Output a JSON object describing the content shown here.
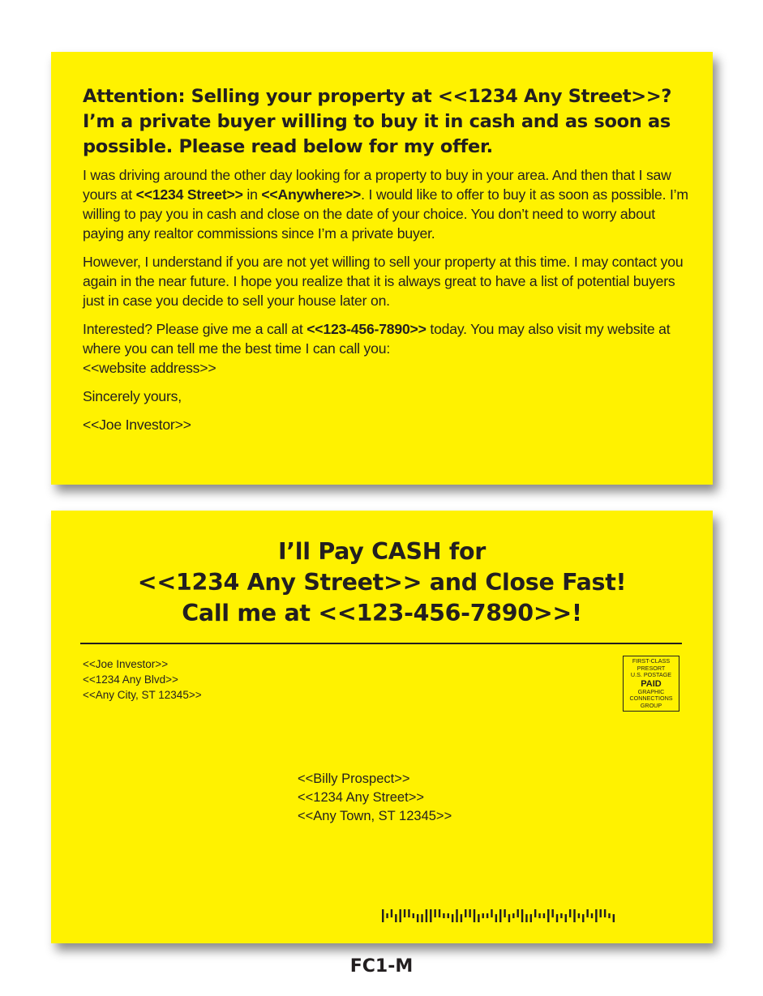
{
  "back": {
    "headline": "Attention: Selling your property at <<1234 Any Street>>? I’m a private buyer willing to buy it in cash and as soon as possible. Please read below for my offer.",
    "p1": {
      "t1": "I was driving around the other day looking for a property to buy in your area. And then that I saw yours at ",
      "b1": "<<1234 Street>>",
      "t2": " in ",
      "b2": "<<Anywhere>>",
      "t3": ". I would like to offer to buy it as soon as possible. I’m willing to pay you in cash and close on the date of your choice. You don’t need to worry about paying any realtor commissions since I’m a private buyer."
    },
    "p2": "However, I understand if you are not yet willing to sell your property at this time. I may contact you again in the near future. I hope you realize that it is always great to have a list of potential buyers just in case you decide to sell your house later on.",
    "p3": {
      "t1": "Interested? Please give me a call at ",
      "b1": "<<123-456-7890>>",
      "t2": " today. You may also visit my website at where you can tell me the best time I can call you:",
      "t3": "<<website address>>"
    },
    "closing": "Sincerely yours,",
    "signature": "<<Joe Investor>>"
  },
  "front": {
    "headline_lines": [
      "I’ll Pay CASH for",
      "<<1234 Any Street>> and Close Fast!",
      "Call me at <<123-456-7890>>!"
    ],
    "return_address": [
      "<<Joe Investor>>",
      "<<1234 Any Blvd>>",
      "<<Any City, ST 12345>>"
    ],
    "indicia": {
      "line1": "FIRST-CLASS",
      "line2": "PRESORT",
      "line3": "U.S. POSTAGE",
      "paid": "PAID",
      "line4": "GRAPHIC",
      "line5": "CONNECTIONS",
      "line6": "GROUP"
    },
    "recipient": [
      "<<Billy Prospect>>",
      "<<1234 Any Street>>",
      "<<Any Town, ST 12345>>"
    ],
    "barcode_pattern": "FTADFAATDDFFAATTDFDAAFDTTADFADTAFDDATTFADTDAFTDATFAATD"
  },
  "footer_code": "FC1-M",
  "colors": {
    "card": "#fff200",
    "ink": "#231f20"
  }
}
